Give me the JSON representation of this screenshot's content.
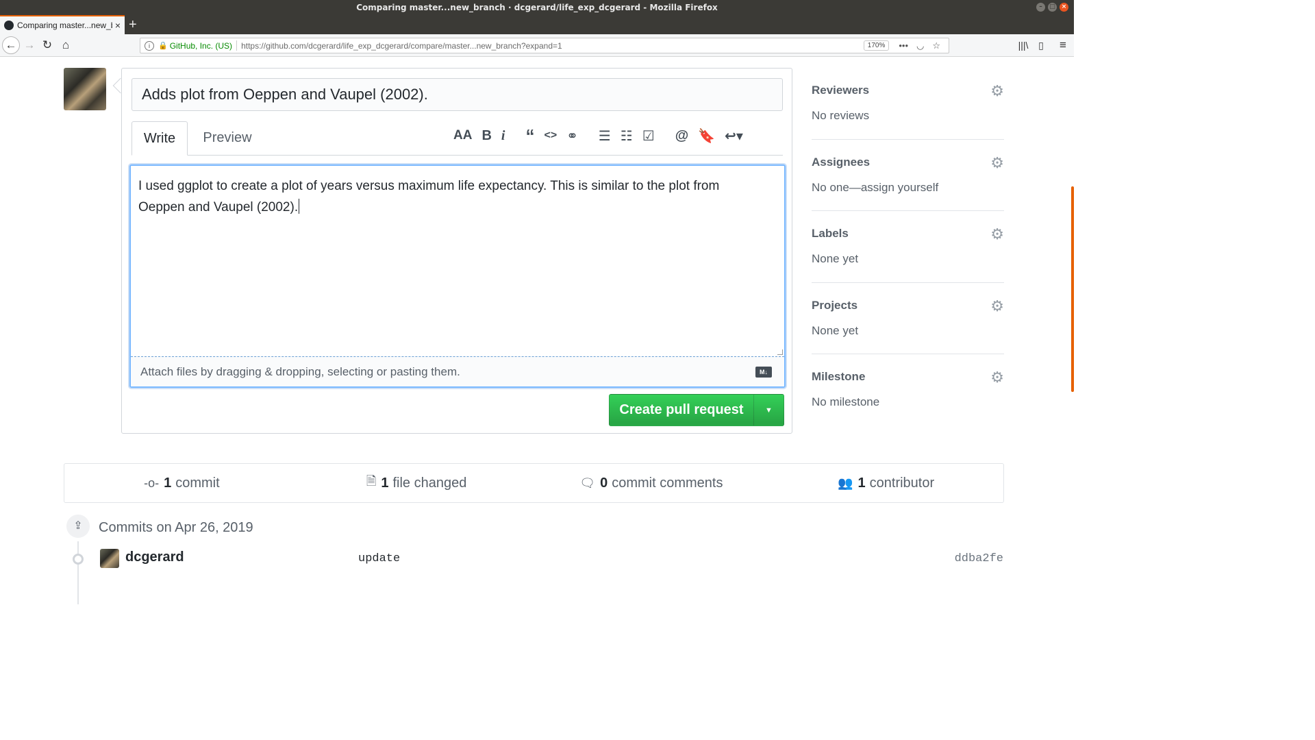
{
  "window": {
    "title": "Comparing master...new_branch · dcgerard/life_exp_dcgerard - Mozilla Firefox"
  },
  "browser": {
    "tab_title": "Comparing master...new_branch",
    "new_tab_label": "+",
    "url_identity": "GitHub, Inc. (US)",
    "url": "https://github.com/dcgerard/life_exp_dcgerard/compare/master...new_branch?expand=1",
    "zoom": "170%"
  },
  "pr_form": {
    "title_value": "Adds plot from Oeppen and Vaupel (2002).",
    "tabs": {
      "write": "Write",
      "preview": "Preview"
    },
    "toolbar_icons": [
      "header-icon",
      "bold-icon",
      "italic-icon",
      "quote-icon",
      "code-icon",
      "link-icon",
      "bullet-list-icon",
      "numbered-list-icon",
      "task-list-icon",
      "mention-icon",
      "reference-icon",
      "reply-icon"
    ],
    "body_text": "I used ggplot to create a plot of years versus maximum life expectancy. This is similar to the plot from Oeppen and Vaupel (2002).",
    "attach_hint": "Attach files by dragging & dropping, selecting or pasting them.",
    "create_button": "Create pull request"
  },
  "sidebar": {
    "sections": [
      {
        "heading": "Reviewers",
        "value": "No reviews"
      },
      {
        "heading": "Assignees",
        "value": "No one—assign yourself"
      },
      {
        "heading": "Labels",
        "value": "None yet"
      },
      {
        "heading": "Projects",
        "value": "None yet"
      },
      {
        "heading": "Milestone",
        "value": "No milestone"
      }
    ]
  },
  "stats": {
    "commits": {
      "count": "1",
      "label": "commit"
    },
    "files": {
      "count": "1",
      "label": "file changed"
    },
    "comments": {
      "count": "0",
      "label": "commit comments"
    },
    "contributors": {
      "count": "1",
      "label": "contributor"
    }
  },
  "commits": {
    "date_heading": "Commits on Apr 26, 2019",
    "items": [
      {
        "author": "dcgerard",
        "message": "update",
        "sha": "ddba2fe"
      }
    ]
  },
  "colors": {
    "accent_green": "#28a745",
    "focus_blue": "#79b8ff",
    "firefox_orange": "#e66000"
  }
}
